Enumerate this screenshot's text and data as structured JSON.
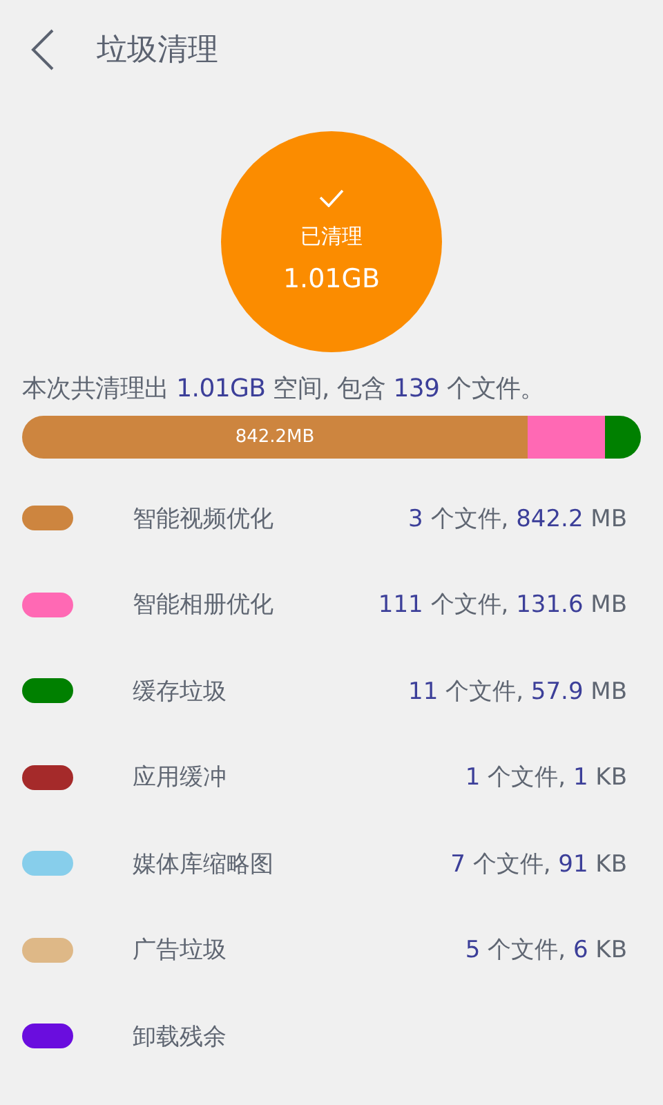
{
  "header": {
    "title": "垃圾清理"
  },
  "result": {
    "status": "已清理",
    "amount": "1.01GB"
  },
  "summary": [
    {
      "text": "本次共清理出 ",
      "em": false
    },
    {
      "text": "1.01GB",
      "em": true
    },
    {
      "text": " 空间, 包含 ",
      "em": false
    },
    {
      "text": "139",
      "em": true
    },
    {
      "text": " 个文件。",
      "em": false
    }
  ],
  "bar": [
    {
      "color": "#cd853f",
      "label": "842.2MB"
    },
    {
      "color": "#ff69b4"
    },
    {
      "color": "#008000"
    }
  ],
  "categories": [
    {
      "name": "智能视频优化",
      "color": "#cd853f",
      "value": [
        {
          "text": "3",
          "em": true
        },
        {
          "text": " 个文件, ",
          "em": false
        },
        {
          "text": "842.2",
          "em": true
        },
        {
          "text": " MB",
          "em": false
        }
      ]
    },
    {
      "name": "智能相册优化",
      "color": "#ff69b4",
      "value": [
        {
          "text": "111",
          "em": true
        },
        {
          "text": " 个文件, ",
          "em": false
        },
        {
          "text": "131.6",
          "em": true
        },
        {
          "text": " MB",
          "em": false
        }
      ]
    },
    {
      "name": "缓存垃圾",
      "color": "#008000",
      "value": [
        {
          "text": "11",
          "em": true
        },
        {
          "text": " 个文件, ",
          "em": false
        },
        {
          "text": "57.9",
          "em": true
        },
        {
          "text": " MB",
          "em": false
        }
      ]
    },
    {
      "name": "应用缓冲",
      "color": "#a52a2a",
      "value": [
        {
          "text": "1",
          "em": true
        },
        {
          "text": " 个文件, ",
          "em": false
        },
        {
          "text": "1",
          "em": true
        },
        {
          "text": " KB",
          "em": false
        }
      ]
    },
    {
      "name": "媒体库缩略图",
      "color": "#87ceeb",
      "value": [
        {
          "text": "7",
          "em": true
        },
        {
          "text": " 个文件, ",
          "em": false
        },
        {
          "text": "91",
          "em": true
        },
        {
          "text": " KB",
          "em": false
        }
      ]
    },
    {
      "name": "广告垃圾",
      "color": "#deb887",
      "value": [
        {
          "text": "5",
          "em": true
        },
        {
          "text": " 个文件, ",
          "em": false
        },
        {
          "text": "6",
          "em": true
        },
        {
          "text": " KB",
          "em": false
        }
      ]
    },
    {
      "name": "卸载残余",
      "color": "#6a0dde"
    }
  ]
}
